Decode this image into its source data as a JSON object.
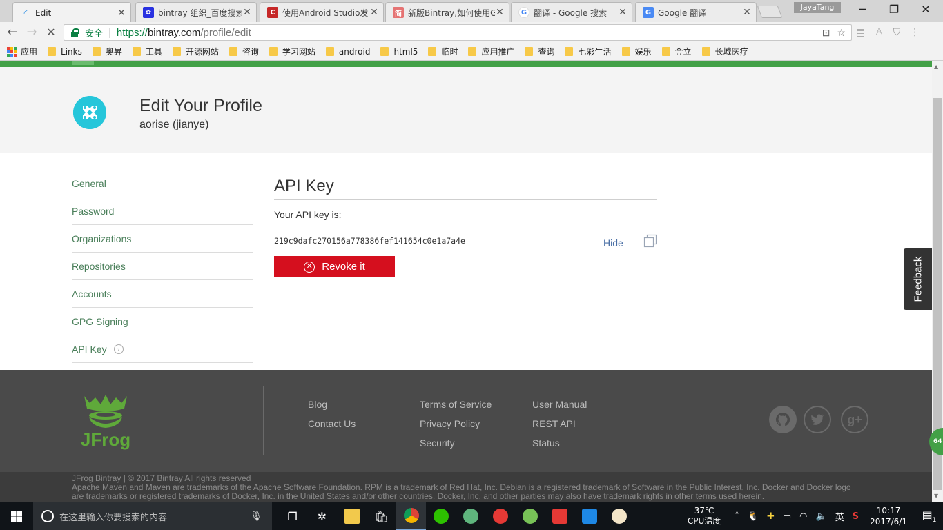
{
  "browser": {
    "tabs": [
      {
        "title": "Edit",
        "favicon_color": "#1e88e5",
        "active": true
      },
      {
        "title": "bintray 组织_百度搜索",
        "favicon_color": "#2932e1",
        "active": false
      },
      {
        "title": "使用Android Studio发",
        "favicon_color": "#c62828",
        "active": false
      },
      {
        "title": "新版Bintray,如何使用G",
        "favicon_color": "#e57373",
        "active": false
      },
      {
        "title": "翻译 - Google 搜索",
        "favicon_color": "#4285f4",
        "active": false
      },
      {
        "title": "Google 翻译",
        "favicon_color": "#4a8af4",
        "active": false
      }
    ],
    "profile_name": "JayaTang",
    "address": {
      "secure_label": "安全",
      "scheme": "https://",
      "host": "bintray.com",
      "path": "/profile/edit"
    },
    "bookmarks": [
      {
        "label": "应用",
        "type": "apps"
      },
      {
        "label": "Links",
        "type": "folder"
      },
      {
        "label": "奥昇",
        "type": "folder"
      },
      {
        "label": "工具",
        "type": "folder"
      },
      {
        "label": "开源网站",
        "type": "folder"
      },
      {
        "label": "咨询",
        "type": "folder"
      },
      {
        "label": "学习网站",
        "type": "folder"
      },
      {
        "label": "android",
        "type": "folder"
      },
      {
        "label": "html5",
        "type": "folder"
      },
      {
        "label": "临时",
        "type": "folder"
      },
      {
        "label": "应用推广",
        "type": "folder"
      },
      {
        "label": "查询",
        "type": "folder"
      },
      {
        "label": "七彩生活",
        "type": "folder"
      },
      {
        "label": "娱乐",
        "type": "folder"
      },
      {
        "label": "金立",
        "type": "folder"
      },
      {
        "label": "长城医疗",
        "type": "folder"
      }
    ]
  },
  "profile": {
    "title": "Edit Your Profile",
    "subtitle": "aorise (jianye)"
  },
  "sidenav": {
    "items": [
      {
        "label": "General",
        "active": false
      },
      {
        "label": "Password",
        "active": false
      },
      {
        "label": "Organizations",
        "active": false
      },
      {
        "label": "Repositories",
        "active": false
      },
      {
        "label": "Accounts",
        "active": false
      },
      {
        "label": "GPG Signing",
        "active": false
      },
      {
        "label": "API Key",
        "active": true
      }
    ]
  },
  "api_key": {
    "section_title": "API Key",
    "label": "Your API key is:",
    "value": "219c9dafc270156a778386fef141654c0e1a7a4e",
    "hide_label": "Hide",
    "revoke_label": "Revoke it"
  },
  "feedback_label": "Feedback",
  "footer": {
    "col1": [
      "Blog",
      "Contact Us"
    ],
    "col2": [
      "Terms of Service",
      "Privacy Policy",
      "Security"
    ],
    "col3": [
      "User Manual",
      "REST API",
      "Status"
    ],
    "copyright": "JFrog Bintray | © 2017 Bintray All rights reserved",
    "trademark": "Apache Maven and Maven are trademarks of the Apache Software Foundation. RPM is a trademark of Red Hat, Inc. Debian is a registered trademark of Software in the Public Interest, Inc. Docker and Docker logo are trademarks or registered trademarks of Docker, Inc. in the United States and/or other countries. Docker, Inc. and other parties may also have trademark rights in other terms used herein.",
    "logo_text": "JFrog"
  },
  "taskbar": {
    "search_placeholder": "在这里输入你要搜索的内容",
    "temperature": "37℃",
    "temp_label": "CPU温度",
    "ime": "英",
    "time": "10:17",
    "date": "2017/6/1",
    "notification_count": "1",
    "side_badge": "64"
  },
  "colors": {
    "brand_green": "#43a047",
    "revoke_red": "#d50f1e",
    "link_green": "#4a7f5a",
    "avatar_teal": "#26c6da"
  }
}
